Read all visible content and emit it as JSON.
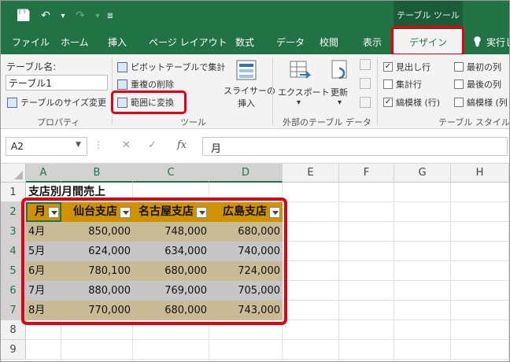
{
  "titlebar": {
    "tool_context": "テーブル ツール",
    "qat": [
      {
        "name": "save-icon",
        "glyph": "💾"
      },
      {
        "name": "undo-icon",
        "glyph": "↶"
      },
      {
        "name": "dropdown-icon",
        "glyph": "▾"
      },
      {
        "name": "redo-icon",
        "glyph": "↷"
      },
      {
        "name": "dropdown-icon",
        "glyph": "▾"
      },
      {
        "name": "customize-qat-icon",
        "glyph": "≣"
      }
    ]
  },
  "tabs": [
    {
      "label": "ファイル"
    },
    {
      "label": "ホーム"
    },
    {
      "label": "挿入"
    },
    {
      "label": "ページ レイアウト"
    },
    {
      "label": "数式"
    },
    {
      "label": "データ"
    },
    {
      "label": "校閲"
    },
    {
      "label": "表示"
    }
  ],
  "active_tab": "デザイン",
  "tell_me": "実行し",
  "tell_me_icon": "💡",
  "ribbon": {
    "properties": {
      "table_name_label": "テーブル名:",
      "table_name_value": "テーブル1",
      "resize_table": "テーブルのサイズ変更",
      "group_label": "プロパティ"
    },
    "tools": {
      "pivot_summary": "ピボットテーブルで集計",
      "remove_duplicates": "重複の削除",
      "convert_to_range": "範囲に変換",
      "insert_slicer_line1": "スライサーの",
      "insert_slicer_line2": "挿入",
      "group_label": "ツール"
    },
    "external": {
      "export": "エクスポート",
      "export_arrow": "▾",
      "refresh": "更新",
      "refresh_arrow": "▾",
      "group_label": "外部のテーブル データ"
    },
    "style_options": {
      "header_row": "見出し行",
      "total_row": "集計行",
      "banded_rows": "縞模様 (行)",
      "first_column": "最初の列",
      "last_column": "最後の列",
      "banded_columns": "縞模様 (列",
      "header_row_checked": true,
      "total_row_checked": false,
      "banded_rows_checked": true,
      "first_column_checked": false,
      "last_column_checked": false,
      "banded_columns_checked": false,
      "group_label": "テーブル スタイルのオ"
    }
  },
  "formula_bar": {
    "name_box": "A2",
    "cancel": "✕",
    "enter": "✓",
    "fx": "fx",
    "formula": "月"
  },
  "sheet": {
    "columns": [
      "A",
      "B",
      "C",
      "D",
      "E",
      "F",
      "G",
      "H"
    ],
    "rows": [
      "1",
      "2",
      "3",
      "4",
      "5",
      "6",
      "7",
      "8",
      "9"
    ],
    "title": "支店別月間売上",
    "table_headers": [
      "月",
      "仙台支店",
      "名古屋支店",
      "広島支店"
    ],
    "table_rows": [
      [
        "4月",
        "850,000",
        "748,000",
        "680,000"
      ],
      [
        "5月",
        "624,000",
        "634,000",
        "740,000"
      ],
      [
        "6月",
        "780,100",
        "680,000",
        "724,000"
      ],
      [
        "7月",
        "880,000",
        "769,000",
        "705,000"
      ],
      [
        "8月",
        "770,000",
        "680,000",
        "743,000"
      ]
    ],
    "band_color_odd": "#c9bb96",
    "band_color_even": "#c6c6c6",
    "header_color": "#cf9200"
  },
  "colors": {
    "excel_green": "#217346",
    "highlight_red": "#e60012"
  }
}
